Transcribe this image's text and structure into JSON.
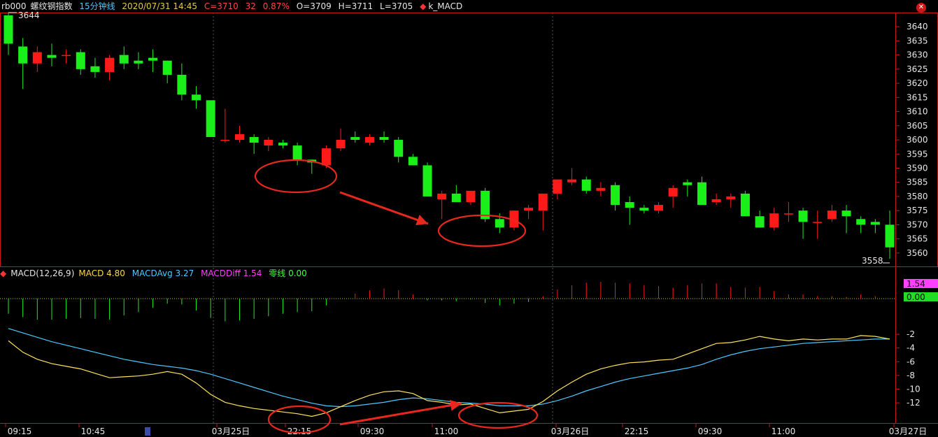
{
  "header": {
    "symbol": "rb000",
    "name": "螺纹钢指数",
    "period": "15分钟线",
    "datetime": "2020/07/31 14:45",
    "close": "C=3710",
    "change": "32",
    "change_pct": "0.87%",
    "open": "O=3709",
    "high": "H=3711",
    "low": "L=3705",
    "indicator": "k_MACD"
  },
  "macd_header": {
    "title": "MACD(12,26,9)",
    "macd": "MACD 4.80",
    "avg": "MACDAvg 3.27",
    "diff": "MACDDiff 1.54",
    "zero": "零线 0.00"
  },
  "price_axis": {
    "labels": [
      "3640",
      "3635",
      "3630",
      "3625",
      "3620",
      "3615",
      "3610",
      "3605",
      "3600",
      "3595",
      "3590",
      "3585",
      "3580",
      "3575",
      "3570",
      "3565",
      "3560"
    ]
  },
  "macd_axis": {
    "labels": [
      "1.54",
      "0.00",
      "-2",
      "-4",
      "-6",
      "-8",
      "-10",
      "-12"
    ],
    "highlight_diff": "1.54",
    "highlight_zero": "0.00"
  },
  "time_axis": {
    "labels": [
      "09:15",
      "10:45",
      "03月25日",
      "22:15",
      "09:30",
      "11:00",
      "03月26日",
      "22:15",
      "09:30",
      "11:00",
      "03月27日"
    ]
  },
  "annotations": {
    "high_label": "3644",
    "low_label": "3558"
  },
  "colors": {
    "up": "#ff1a1a",
    "down": "#1aef1a",
    "frame": "#c81818",
    "grid": "#3a3a3a",
    "macd_line": "#ffe45a",
    "avg_line": "#4ec9ff",
    "markup": "#e8281c"
  },
  "chart_data": {
    "type": "candlestick",
    "ylim": [
      3557,
      3644
    ],
    "candles": [
      {
        "o": 3644,
        "h": 3645,
        "l": 3630,
        "c": 3634
      },
      {
        "o": 3633,
        "h": 3636,
        "l": 3618,
        "c": 3627
      },
      {
        "o": 3627,
        "h": 3633,
        "l": 3624,
        "c": 3631
      },
      {
        "o": 3630,
        "h": 3634,
        "l": 3626,
        "c": 3629
      },
      {
        "o": 3630,
        "h": 3632,
        "l": 3627,
        "c": 3630
      },
      {
        "o": 3631,
        "h": 3632,
        "l": 3623,
        "c": 3625
      },
      {
        "o": 3626,
        "h": 3629,
        "l": 3622,
        "c": 3624
      },
      {
        "o": 3624,
        "h": 3630,
        "l": 3621,
        "c": 3629
      },
      {
        "o": 3630,
        "h": 3633,
        "l": 3625,
        "c": 3627
      },
      {
        "o": 3628,
        "h": 3631,
        "l": 3625,
        "c": 3627
      },
      {
        "o": 3629,
        "h": 3632,
        "l": 3624,
        "c": 3628
      },
      {
        "o": 3628,
        "h": 3628,
        "l": 3620,
        "c": 3623
      },
      {
        "o": 3623,
        "h": 3627,
        "l": 3614,
        "c": 3616
      },
      {
        "o": 3616,
        "h": 3619,
        "l": 3611,
        "c": 3614
      },
      {
        "o": 3614,
        "h": 3614,
        "l": 3601,
        "c": 3601
      },
      {
        "o": 3600,
        "h": 3611,
        "l": 3599,
        "c": 3600
      },
      {
        "o": 3600,
        "h": 3605,
        "l": 3599,
        "c": 3602
      },
      {
        "o": 3601,
        "h": 3602,
        "l": 3595,
        "c": 3599
      },
      {
        "o": 3598,
        "h": 3601,
        "l": 3596,
        "c": 3600
      },
      {
        "o": 3599,
        "h": 3600,
        "l": 3597,
        "c": 3598
      },
      {
        "o": 3598,
        "h": 3599,
        "l": 3591,
        "c": 3593
      },
      {
        "o": 3593,
        "h": 3593,
        "l": 3588,
        "c": 3592
      },
      {
        "o": 3591,
        "h": 3598,
        "l": 3590,
        "c": 3597
      },
      {
        "o": 3597,
        "h": 3604,
        "l": 3596,
        "c": 3600
      },
      {
        "o": 3601,
        "h": 3603,
        "l": 3599,
        "c": 3600
      },
      {
        "o": 3599,
        "h": 3602,
        "l": 3598,
        "c": 3601
      },
      {
        "o": 3601,
        "h": 3603,
        "l": 3599,
        "c": 3600
      },
      {
        "o": 3600,
        "h": 3601,
        "l": 3592,
        "c": 3594
      },
      {
        "o": 3594,
        "h": 3595,
        "l": 3591,
        "c": 3591
      },
      {
        "o": 3591,
        "h": 3592,
        "l": 3580,
        "c": 3580
      },
      {
        "o": 3579,
        "h": 3582,
        "l": 3572,
        "c": 3581
      },
      {
        "o": 3581,
        "h": 3584,
        "l": 3578,
        "c": 3578
      },
      {
        "o": 3578,
        "h": 3581,
        "l": 3577,
        "c": 3582
      },
      {
        "o": 3582,
        "h": 3583,
        "l": 3571,
        "c": 3572
      },
      {
        "o": 3572,
        "h": 3574,
        "l": 3567,
        "c": 3569
      },
      {
        "o": 3569,
        "h": 3575,
        "l": 3568,
        "c": 3575
      },
      {
        "o": 3575,
        "h": 3577,
        "l": 3572,
        "c": 3576
      },
      {
        "o": 3575,
        "h": 3578,
        "l": 3568,
        "c": 3581
      },
      {
        "o": 3581,
        "h": 3583,
        "l": 3579,
        "c": 3586
      },
      {
        "o": 3585,
        "h": 3590,
        "l": 3584,
        "c": 3586
      },
      {
        "o": 3586,
        "h": 3587,
        "l": 3581,
        "c": 3582
      },
      {
        "o": 3582,
        "h": 3585,
        "l": 3580,
        "c": 3583
      },
      {
        "o": 3584,
        "h": 3585,
        "l": 3575,
        "c": 3577
      },
      {
        "o": 3578,
        "h": 3580,
        "l": 3570,
        "c": 3576
      },
      {
        "o": 3576,
        "h": 3577,
        "l": 3574,
        "c": 3575
      },
      {
        "o": 3575,
        "h": 3578,
        "l": 3574,
        "c": 3577
      },
      {
        "o": 3580,
        "h": 3584,
        "l": 3576,
        "c": 3583
      },
      {
        "o": 3585,
        "h": 3586,
        "l": 3580,
        "c": 3584
      },
      {
        "o": 3585,
        "h": 3587,
        "l": 3577,
        "c": 3577
      },
      {
        "o": 3578,
        "h": 3581,
        "l": 3577,
        "c": 3579
      },
      {
        "o": 3579,
        "h": 3581,
        "l": 3576,
        "c": 3580
      },
      {
        "o": 3581,
        "h": 3582,
        "l": 3573,
        "c": 3573
      },
      {
        "o": 3573,
        "h": 3575,
        "l": 3569,
        "c": 3569
      },
      {
        "o": 3569,
        "h": 3576,
        "l": 3568,
        "c": 3574
      },
      {
        "o": 3574,
        "h": 3578,
        "l": 3571,
        "c": 3574
      },
      {
        "o": 3575,
        "h": 3576,
        "l": 3565,
        "c": 3571
      },
      {
        "o": 3571,
        "h": 3575,
        "l": 3565,
        "c": 3571
      },
      {
        "o": 3572,
        "h": 3577,
        "l": 3571,
        "c": 3575
      },
      {
        "o": 3575,
        "h": 3577,
        "l": 3567,
        "c": 3573
      },
      {
        "o": 3572,
        "h": 3573,
        "l": 3567,
        "c": 3570
      },
      {
        "o": 3571,
        "h": 3572,
        "l": 3567,
        "c": 3570
      },
      {
        "o": 3570,
        "h": 3575,
        "l": 3558,
        "c": 3562
      }
    ],
    "macd": {
      "ylim": [
        -14,
        2
      ],
      "macd": [
        -4.8,
        -6.1,
        -6.9,
        -7.4,
        -7.7,
        -8.0,
        -8.5,
        -9.0,
        -8.9,
        -8.8,
        -8.6,
        -8.3,
        -8.6,
        -9.6,
        -10.9,
        -11.8,
        -12.2,
        -12.5,
        -12.7,
        -12.9,
        -13.1,
        -13.4,
        -13.0,
        -12.3,
        -11.6,
        -11.0,
        -10.6,
        -10.5,
        -10.8,
        -11.6,
        -11.8,
        -12.1,
        -12.0,
        -12.5,
        -13.0,
        -12.8,
        -12.6,
        -11.7,
        -10.5,
        -9.5,
        -8.6,
        -8.0,
        -7.6,
        -7.3,
        -7.2,
        -7.0,
        -6.9,
        -6.3,
        -5.7,
        -5.1,
        -5.0,
        -4.7,
        -4.3,
        -4.6,
        -4.8,
        -4.6,
        -4.7,
        -4.6,
        -4.6,
        -4.2,
        -4.3,
        -4.6
      ],
      "avg": [
        -3.4,
        -3.9,
        -4.4,
        -4.9,
        -5.3,
        -5.7,
        -6.1,
        -6.5,
        -6.9,
        -7.2,
        -7.5,
        -7.7,
        -7.9,
        -8.2,
        -8.6,
        -9.1,
        -9.6,
        -10.1,
        -10.6,
        -11.1,
        -11.5,
        -11.9,
        -12.2,
        -12.3,
        -12.2,
        -12.0,
        -11.8,
        -11.5,
        -11.3,
        -11.4,
        -11.6,
        -11.8,
        -11.9,
        -12.0,
        -12.2,
        -12.2,
        -12.2,
        -12.0,
        -11.6,
        -11.1,
        -10.5,
        -10.0,
        -9.5,
        -9.1,
        -8.8,
        -8.5,
        -8.2,
        -7.9,
        -7.5,
        -6.9,
        -6.4,
        -6.0,
        -5.7,
        -5.5,
        -5.3,
        -5.1,
        -5.0,
        -4.9,
        -4.8,
        -4.7,
        -4.6,
        -4.6
      ],
      "diff": [
        -1.8,
        -2.2,
        -2.5,
        -2.5,
        -2.4,
        -2.3,
        -2.4,
        -2.5,
        -2.0,
        -1.6,
        -1.1,
        -0.6,
        -0.7,
        -1.4,
        -2.3,
        -2.7,
        -2.6,
        -2.4,
        -2.1,
        -1.8,
        -1.6,
        -1.5,
        -0.8,
        0.0,
        0.6,
        1.0,
        1.2,
        1.0,
        0.5,
        -0.2,
        -0.2,
        -0.3,
        -0.1,
        -0.5,
        -0.8,
        -0.6,
        -0.4,
        0.3,
        1.1,
        1.6,
        1.9,
        2.0,
        1.9,
        1.8,
        1.6,
        1.5,
        1.3,
        1.6,
        1.8,
        1.8,
        1.4,
        1.3,
        1.4,
        0.9,
        0.5,
        0.5,
        0.3,
        0.3,
        0.2,
        0.5,
        0.3,
        0.0
      ]
    }
  }
}
